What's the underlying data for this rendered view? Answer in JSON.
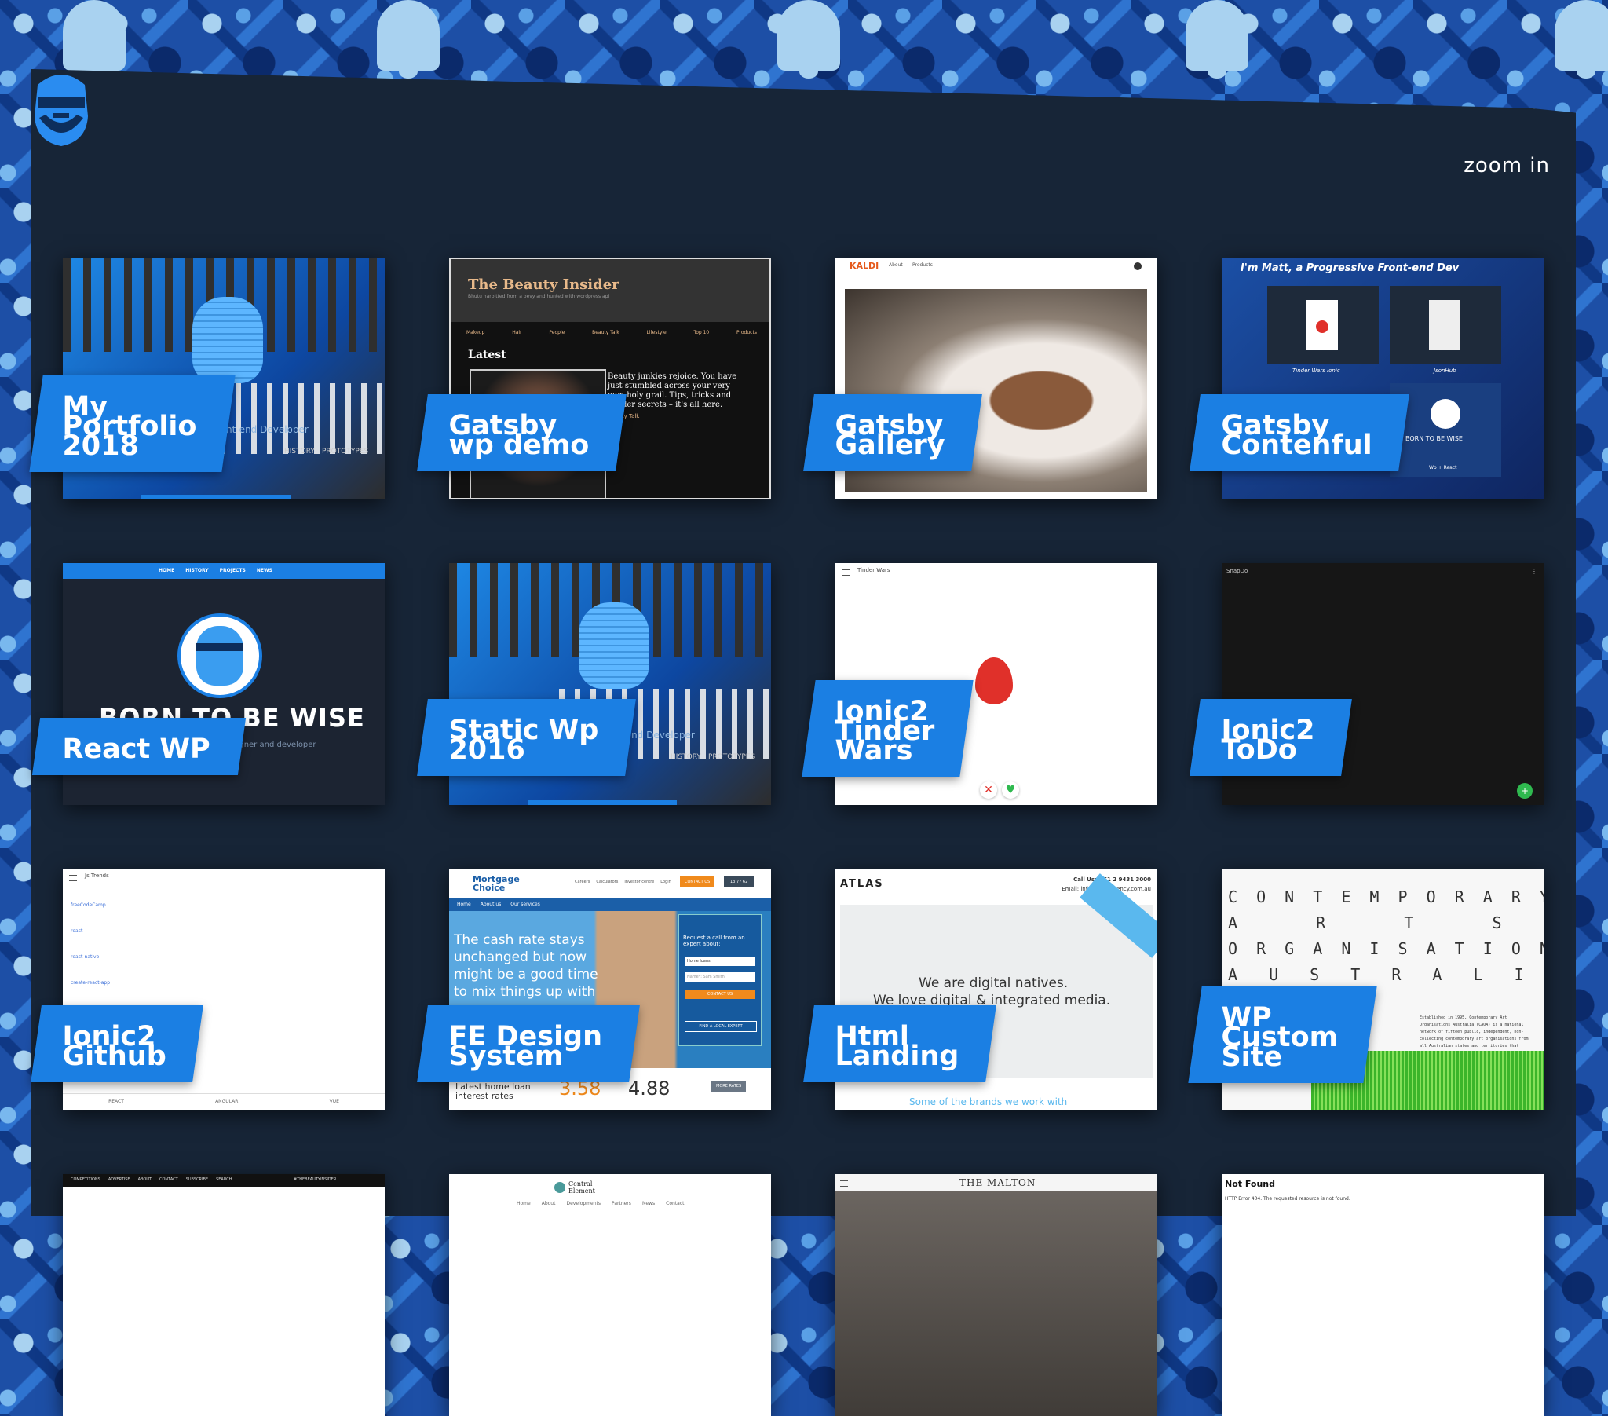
{
  "header": {
    "zoom_label": "zoom in",
    "logo_icon": "pixel-beard-face-icon"
  },
  "colors": {
    "accent": "#1b7fe3",
    "panel": "#172537"
  },
  "projects": [
    {
      "label": "My\nPortfolio\n2018",
      "thumb": {
        "subtitle": "Front-end Developer",
        "nav_history": "HISTORY",
        "nav_prototypes": "PROTOTYPES"
      }
    },
    {
      "label": "Gatsby\nwp demo",
      "thumb": {
        "title": "The Beauty Insider",
        "tagline": "Bhutu harbitted from a bevy and hunted with wordpress api",
        "nav": [
          "Makeup",
          "Hair",
          "People",
          "Beauty Talk",
          "Lifestyle",
          "Top 10",
          "Products"
        ],
        "latest": "Latest",
        "post": "Beauty junkies rejoice. You have just stumbled across your very own holy grail. Tips, tricks and insider secrets – it's all here.",
        "post_cat": "Beauty Talk"
      }
    },
    {
      "label": "Gatsby\nGallery",
      "thumb": {
        "brand": "KALDI",
        "nav": [
          "About",
          "Products"
        ]
      }
    },
    {
      "label": "Gatsby\nContenful",
      "thumb": {
        "title": "I'm Matt, a Progressive Front-end Dev",
        "tiles": [
          "Tinder Wars Ionic",
          "JsonHub",
          "Wp + React"
        ],
        "born": "BORN TO BE WISE"
      }
    },
    {
      "label": "React WP",
      "thumb": {
        "nav": [
          "HOME",
          "HISTORY",
          "PROJECTS",
          "NEWS"
        ],
        "title": "BORN TO BE WISE",
        "subtitle": "web designer and developer"
      }
    },
    {
      "label": "Static Wp\n2016",
      "thumb": {
        "subtitle": "Front-end Developer",
        "nav_history": "HISTORY",
        "nav_prototypes": "PROTOTYPES"
      }
    },
    {
      "label": "Ionic2\nTinder\nWars",
      "thumb": {
        "appbar": "Tinder Wars"
      }
    },
    {
      "label": "Ionic2\nToDo",
      "thumb": {
        "appbar": "SnapDo"
      }
    },
    {
      "label": "Ionic2\nGithub",
      "thumb": {
        "appbar": "Js Trends",
        "items": [
          "freeCodeCamp",
          "react",
          "react-native",
          "create-react-app",
          "materialui"
        ],
        "tabs": [
          "REACT",
          "ANGULAR",
          "VUE"
        ]
      }
    },
    {
      "label": "FE Design\nSystem",
      "thumb": {
        "brand": "Mortgage Choice",
        "nav": [
          "Careers",
          "Calculators",
          "Investor centre",
          "Login"
        ],
        "contact": "CONTACT US",
        "phone": "13 77 62",
        "subnav": [
          "Home",
          "About us",
          "Our services"
        ],
        "hero": "The cash rate stays unchanged but now might be a good time to mix things up with your",
        "form_title": "Request a call from an expert about:",
        "form_select": "Home loans",
        "form_name": "Name*: Sam Smith",
        "form_btn": "CONTACT US",
        "form_btn2": "FIND A LOCAL EXPERT",
        "rate_label": "Latest home loan interest rates",
        "rate1": "3.58",
        "rate2": "4.88",
        "more_rates": "MORE RATES"
      }
    },
    {
      "label": "Html\nLanding",
      "thumb": {
        "brand": "ATLAS",
        "call": "Call Us: +61 2 9431 3000",
        "email": "Email: info@atlasagency.com.au",
        "line1": "We are digital natives.",
        "line2": "We love digital & integrated media.",
        "footer": "Some of the brands we work with"
      }
    },
    {
      "label": "WP\nCustom\nSite",
      "thumb": {
        "rows": [
          "C O N T E M P O R A R Y",
          "A   R   T   S",
          "O R G A N I S A T I O N S",
          "A U S T R A L I A"
        ],
        "about": "Established in 1995, Contemporary Art Organisations Australia (CAOA) is a national network of fifteen public, independent, non-collecting contemporary art organisations from all Australian states and territories that advocate for the small-to-medium contemporary visual arts sector in Australia."
      }
    },
    {
      "label": "",
      "thumb": {
        "nav": [
          "COMPETITIONS",
          "ADVERTISE",
          "ABOUT",
          "CONTACT",
          "SUBSCRIBE",
          "SEARCH"
        ],
        "tag": "#THEBEAUTYINSIDER"
      }
    },
    {
      "label": "",
      "thumb": {
        "brand": "Central Element",
        "nav": [
          "Home",
          "About",
          "Developments",
          "Partners",
          "News",
          "Contact"
        ]
      }
    },
    {
      "label": "",
      "thumb": {
        "brand": "THE MALTON"
      }
    },
    {
      "label": "",
      "thumb": {
        "title": "Not Found",
        "text": "HTTP Error 404. The requested resource is not found."
      }
    }
  ]
}
